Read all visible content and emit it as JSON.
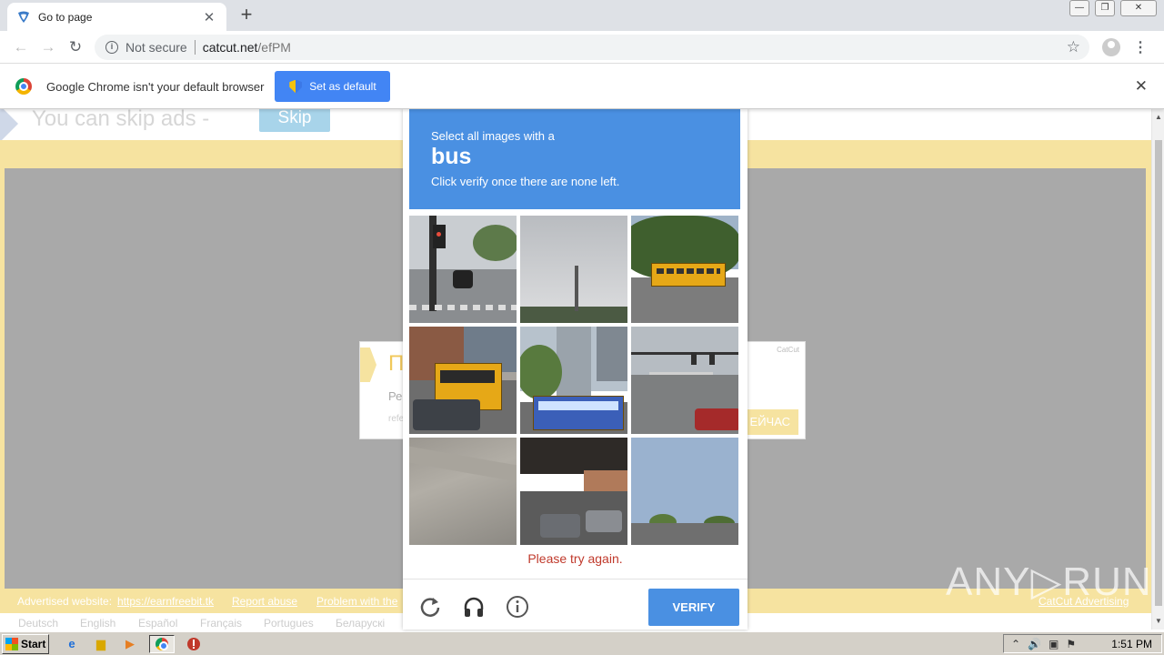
{
  "browser": {
    "tab_title": "Go to page",
    "new_tab_label": "+",
    "window_controls": [
      "—",
      "❐",
      "✕"
    ],
    "not_secure_label": "Not secure",
    "url_host": "catcut.net",
    "url_path": "/efPM"
  },
  "infobar": {
    "message": "Google Chrome isn't your default browser",
    "button_label": "Set as default"
  },
  "page": {
    "skip_text": "You can skip ads  -",
    "skip_button": "Skip",
    "ad": {
      "letter": "П",
      "line1": "Ре",
      "line2": "refe",
      "tag": "CatCut",
      "cta": "ЕЙЧАС"
    },
    "footer": {
      "advertised_label": "Advertised website:",
      "advertised_link": "https://earnfreebit.tk",
      "report_abuse": "Report abuse",
      "problem": "Problem with the",
      "catcut_ad": "CatCut Advertising"
    },
    "languages": [
      "Deutsch",
      "English",
      "Español",
      "Français",
      "Portugues",
      "Беларускі"
    ]
  },
  "captcha": {
    "instruction_line1": "Select all images with a",
    "target_word": "bus",
    "instruction_line2": "Click verify once there are none left.",
    "error_text": "Please try again.",
    "verify_label": "VERIFY",
    "tiles": [
      {
        "label": "tile-1",
        "contains_bus": false
      },
      {
        "label": "tile-2",
        "contains_bus": false
      },
      {
        "label": "tile-3",
        "contains_bus": true
      },
      {
        "label": "tile-4",
        "contains_bus": true
      },
      {
        "label": "tile-5",
        "contains_bus": true
      },
      {
        "label": "tile-6",
        "contains_bus": false
      },
      {
        "label": "tile-7",
        "contains_bus": false
      },
      {
        "label": "tile-8",
        "contains_bus": false
      },
      {
        "label": "tile-9",
        "contains_bus": false
      }
    ]
  },
  "watermark": "ANY▷RUN",
  "taskbar": {
    "start_label": "Start",
    "clock": "1:51 PM"
  },
  "colors": {
    "captcha_blue": "#4a90e2",
    "error_red": "#c0392b",
    "chrome_blue": "#4285f4",
    "frame_yellow": "#f6e3a0"
  }
}
